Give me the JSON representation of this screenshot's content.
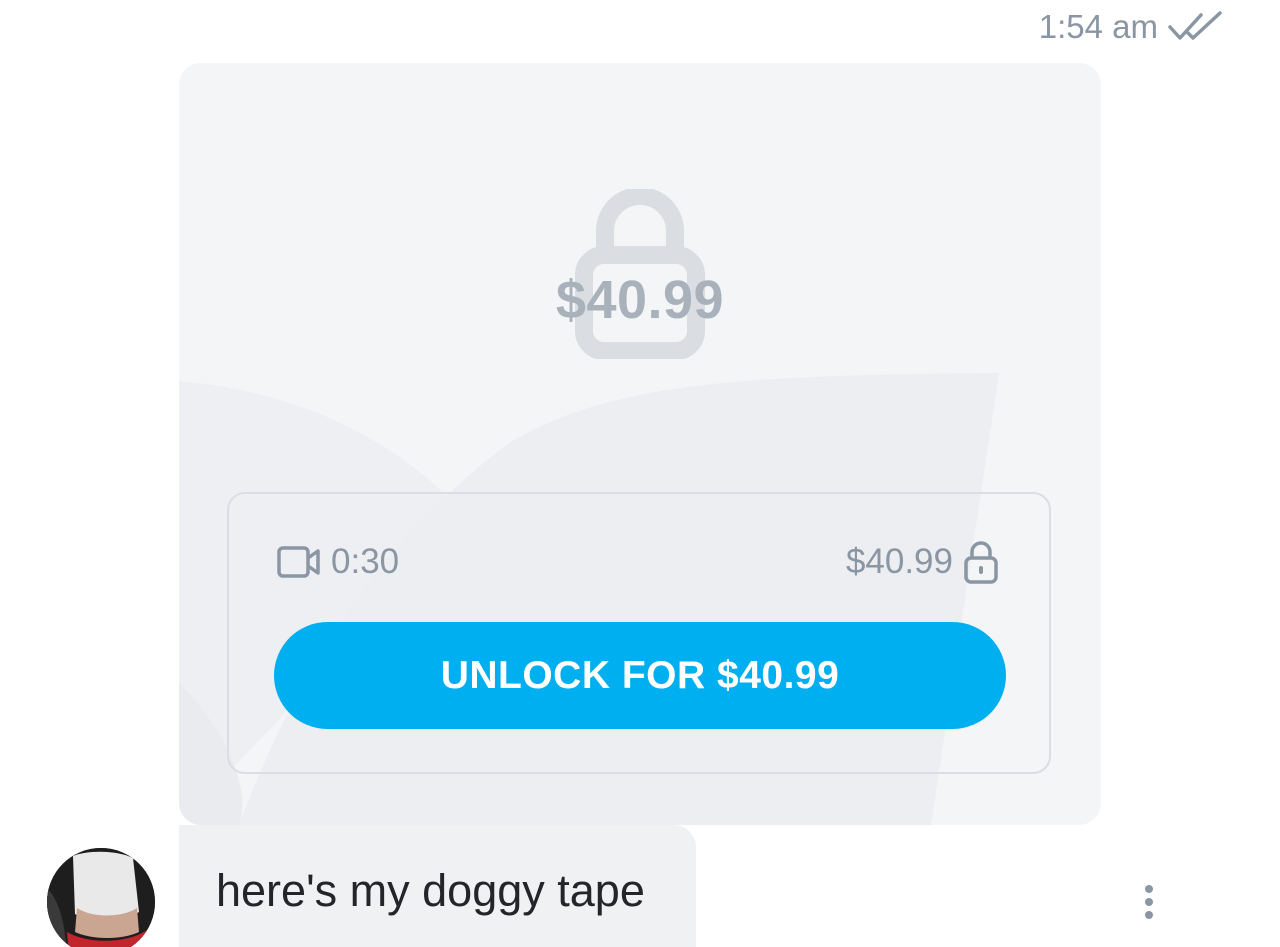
{
  "message": {
    "time": "1:54 am",
    "read_status_icon": "double-check-icon"
  },
  "media": {
    "lock_icon": "lock-icon",
    "price_overlay": "$40.99",
    "video_icon": "video-camera-icon",
    "duration": "0:30",
    "price": "$40.99",
    "small_lock_icon": "lock-icon",
    "unlock_button_label": "UNLOCK FOR $40.99"
  },
  "text_message": {
    "text": "here's my doggy tape"
  },
  "colors": {
    "accent": "#00aff0",
    "muted_text": "#8a96a3",
    "card_bg": "#f4f5f7"
  }
}
